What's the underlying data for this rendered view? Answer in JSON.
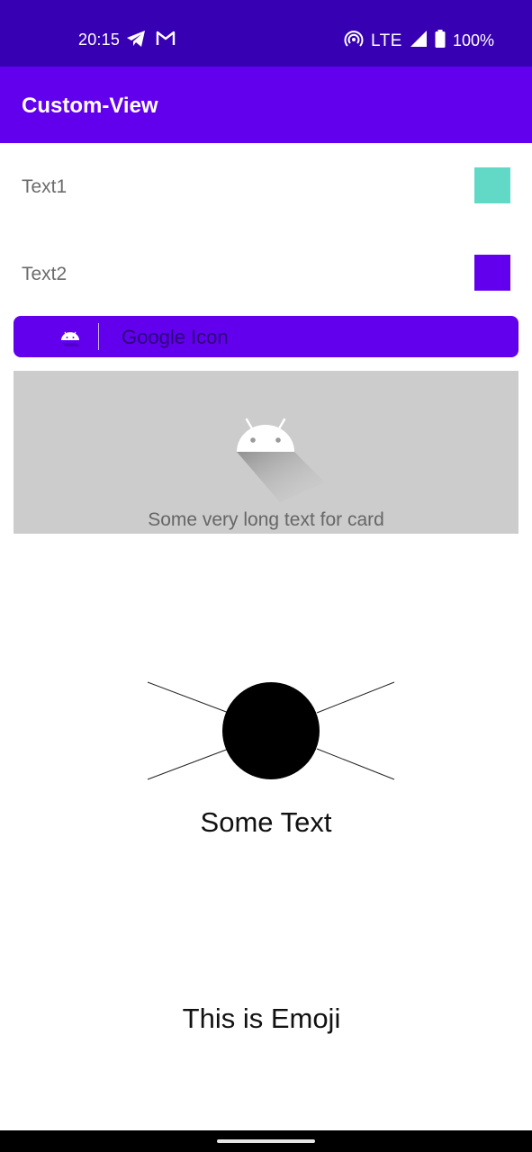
{
  "status_bar": {
    "time": "20:15",
    "network": "LTE",
    "battery": "100%",
    "icons": [
      "telegram-icon",
      "gmail-icon",
      "hotspot-icon",
      "signal-icon",
      "battery-icon"
    ]
  },
  "app_bar": {
    "title": "Custom-View"
  },
  "rows": [
    {
      "label": "Text1",
      "color": "#61d9c6"
    },
    {
      "label": "Text2",
      "color": "#6200ee"
    }
  ],
  "google_button": {
    "label": "Google Icon",
    "icon": "android-icon"
  },
  "card": {
    "text": "Some very long text for card",
    "icon": "android-icon"
  },
  "custom_view": {
    "text": "Some Text"
  },
  "emoji_view": {
    "text": "This is Emoji"
  },
  "colors": {
    "primary": "#6200ee",
    "primary_dark": "#3700b3",
    "teal": "#61d9c6"
  }
}
